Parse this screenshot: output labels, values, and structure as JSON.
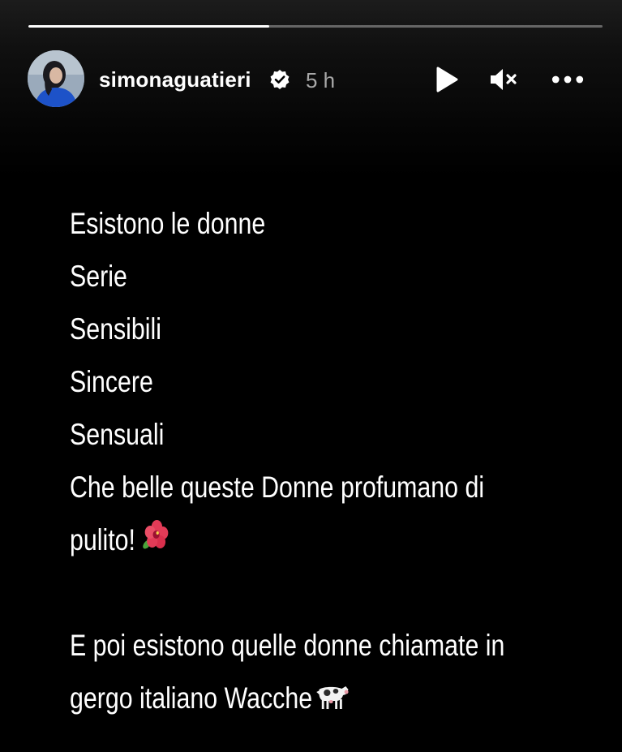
{
  "story": {
    "progress": 0.42,
    "user": {
      "username": "simonaguatieri",
      "verified": true,
      "time_ago": "5 h"
    },
    "controls": {
      "play_icon": "play-icon",
      "mute_icon": "muted-speaker-icon",
      "more_icon": "more-options-icon"
    },
    "text_lines": [
      "Esistono le donne",
      "Serie",
      "Sensibili",
      "Sincere",
      "Sensuali",
      "Che belle queste Donne profumano di",
      "pulito!",
      "",
      "E poi esistono quelle donne chiamate in",
      "gergo italiano Wacche"
    ],
    "emojis": [
      "hibiscus-emoji",
      "cow-emoji"
    ]
  }
}
